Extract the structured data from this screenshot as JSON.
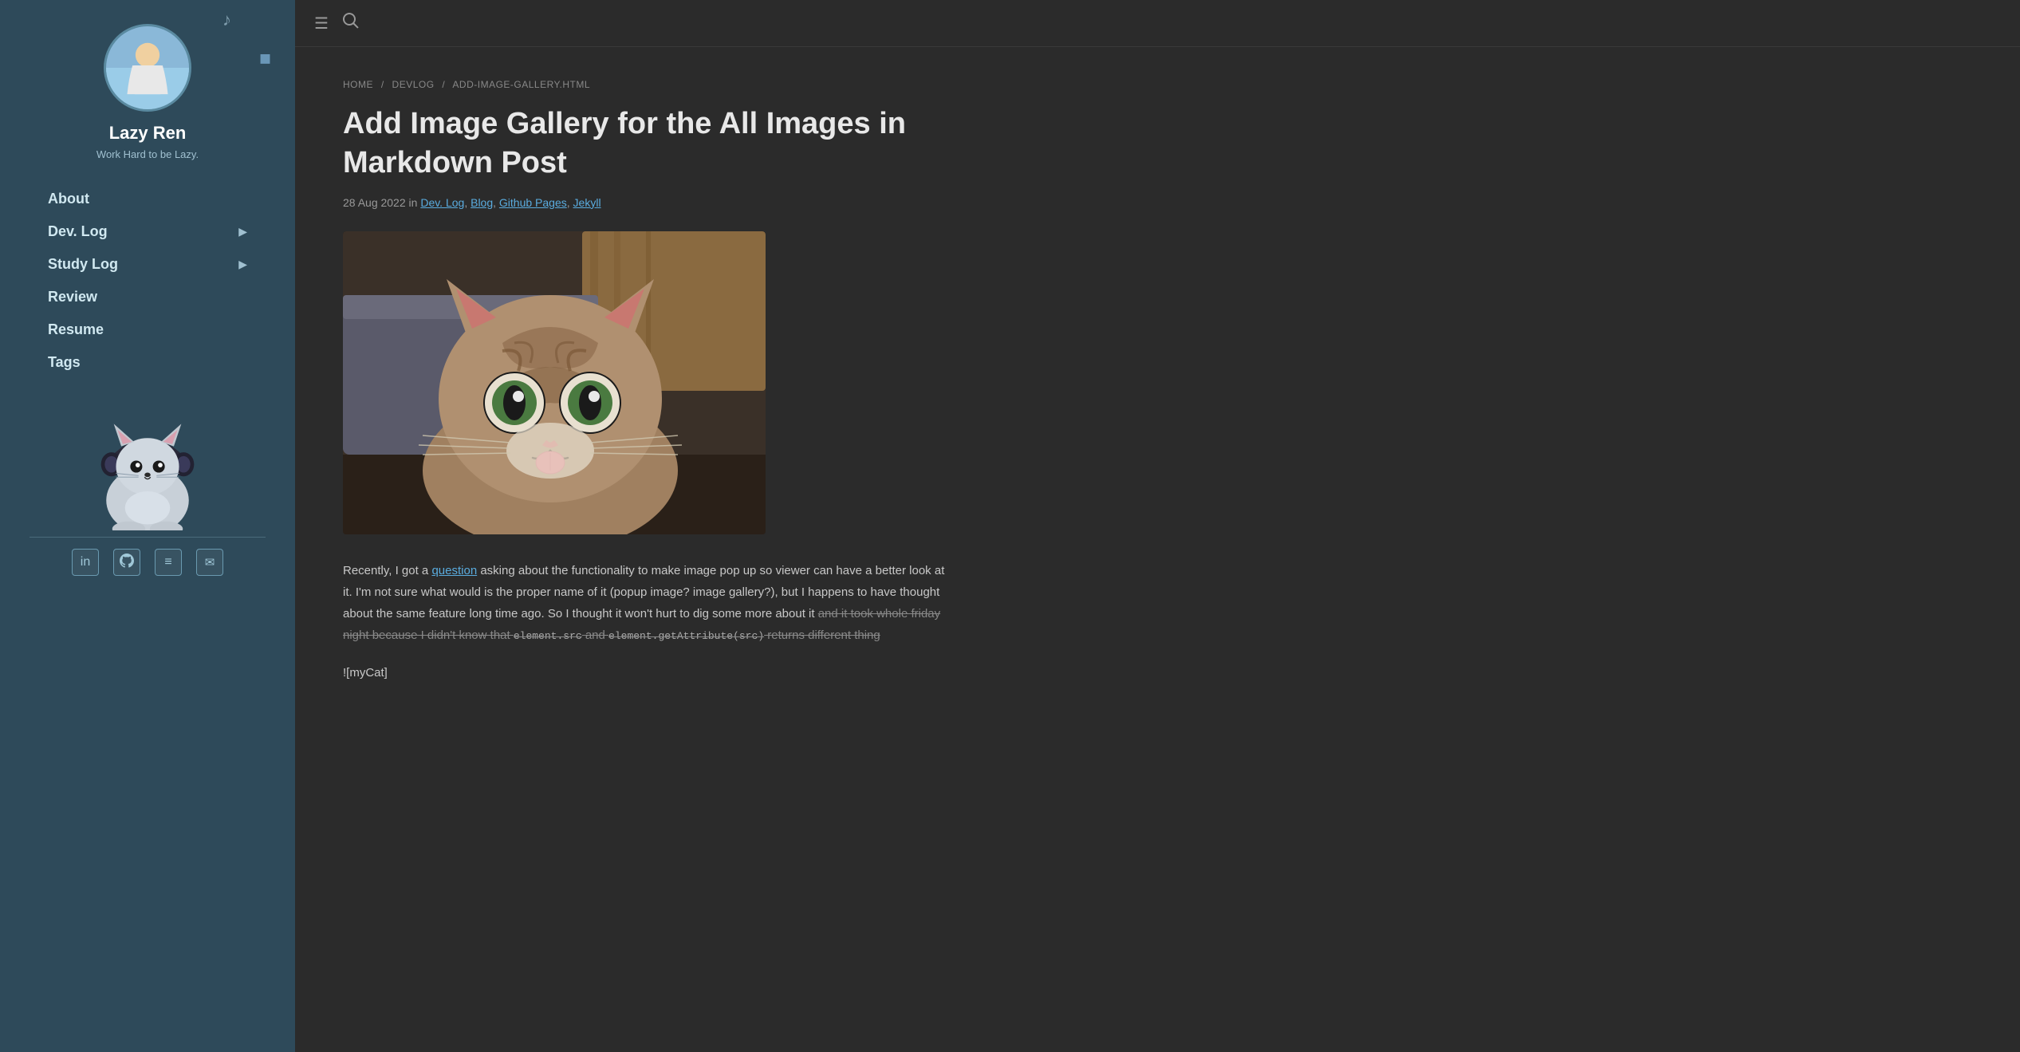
{
  "sidebar": {
    "music_note": "♪",
    "author_name": "Lazy Ren",
    "author_tagline": "Work Hard to be Lazy.",
    "nav_items": [
      {
        "label": "About",
        "has_chevron": false,
        "id": "about"
      },
      {
        "label": "Dev. Log",
        "has_chevron": true,
        "id": "devlog"
      },
      {
        "label": "Study Log",
        "has_chevron": true,
        "id": "studylog"
      },
      {
        "label": "Review",
        "has_chevron": false,
        "id": "review"
      },
      {
        "label": "Resume",
        "has_chevron": false,
        "id": "resume"
      },
      {
        "label": "Tags",
        "has_chevron": false,
        "id": "tags"
      }
    ],
    "social_icons": [
      {
        "name": "linkedin",
        "symbol": "in"
      },
      {
        "name": "github",
        "symbol": "⌥"
      },
      {
        "name": "stackshare",
        "symbol": "≡"
      },
      {
        "name": "email",
        "symbol": "✉"
      }
    ]
  },
  "topbar": {
    "menu_icon": "☰",
    "search_icon": "🔍"
  },
  "breadcrumb": {
    "home": "HOME",
    "devlog": "DEVLOG",
    "current": "ADD-IMAGE-GALLERY.HTML"
  },
  "post": {
    "title": "Add Image Gallery for the All Images in Markdown Post",
    "meta_date": "28 Aug 2022",
    "meta_in": "in",
    "meta_categories": [
      {
        "label": "Dev. Log",
        "url": "#"
      },
      {
        "label": "Blog",
        "url": "#"
      },
      {
        "label": "Github Pages",
        "url": "#"
      },
      {
        "label": "Jekyll",
        "url": "#"
      }
    ],
    "body_paragraph1": "Recently, I got a question asking about the functionality to make image pop up so viewer can have a better look at it. I'm not sure what would is the proper name of it (popup image? image gallery?), but I happens to have thought about the same feature long time ago. So I thought it won't hurt to dig some more about it",
    "body_strikethrough": "and it took whole friday night because I didn't know that",
    "body_code1": "element.src",
    "body_code2": "element.getAttribute(src)",
    "body_strikethrough2": "returns different thing",
    "body_paragraph2": "![myCat]"
  }
}
